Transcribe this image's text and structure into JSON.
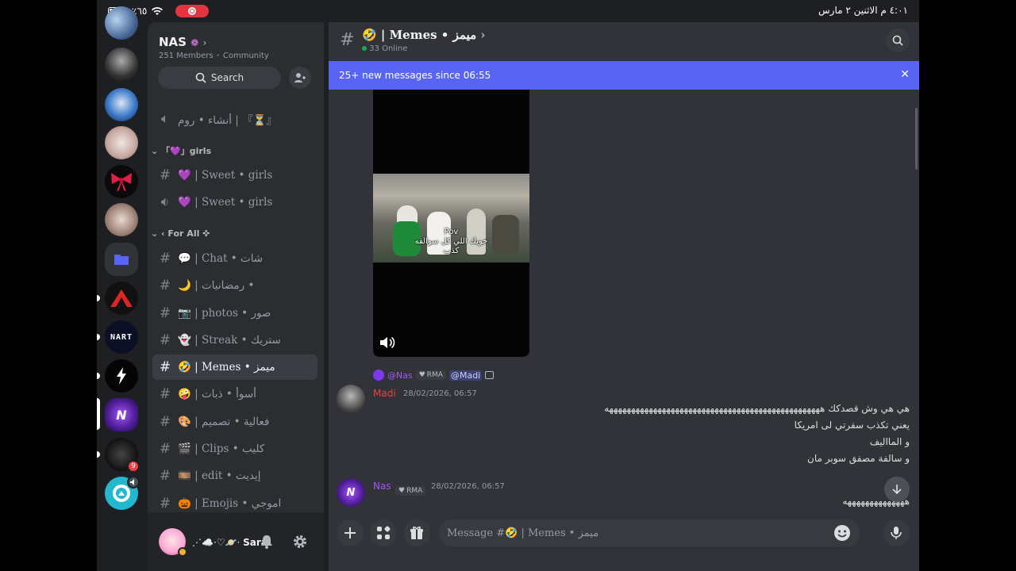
{
  "status_bar": {
    "battery": "٪٦٥",
    "datetime": "٤:٠١ م   الاثنين ٢ مارس"
  },
  "server": {
    "name": "NAS",
    "members": "251 Members",
    "type": "Community",
    "search_label": "Search"
  },
  "channels": [
    {
      "label": "أنشاء • روم | 『⏳』"
    },
    {
      "category": "「💜」girls"
    },
    {
      "label": "💜 | Sweet • girls"
    },
    {
      "label": "💜 | Sweet • girls"
    },
    {
      "category": "For All ✜"
    },
    {
      "label": "💬 | Chat • شات"
    },
    {
      "label": "🌙 | رمضانيات •"
    },
    {
      "label": "📷 | photos • صور"
    },
    {
      "label": "👻 | Streak • ستريك"
    },
    {
      "label": "🤣 | Memes • ميمز"
    },
    {
      "label": "🤪 | أسوأ • ذبات"
    },
    {
      "label": "🎨 | فعالية • تصميم"
    },
    {
      "label": "🎬 | Clips • كليب"
    },
    {
      "label": "🎞️ | edit • إيديت"
    },
    {
      "label": "🎃 | Emojis • اموجي"
    }
  ],
  "user": {
    "name": "Sara",
    "status": "⋰☁️·♡🪐·"
  },
  "main_header": {
    "channel": "🤣 | Memes • ميمز",
    "online": "33 Online"
  },
  "banner": {
    "text": "25+ new messages since 06:55"
  },
  "video": {
    "caption_1": "Pov",
    "caption_2": "خويك اللي كل سوالفه",
    "caption_3": "كذب"
  },
  "messages": [
    {
      "reply_to": "@Nas",
      "reply_tag": "RMA",
      "reply_mention": "@Madi",
      "author": "Madi",
      "time": "28/02/2026, 06:57",
      "lines": [
        "هي هي وش قصدكك هههههههههههههههههههههههههههههههههههههههههههههههههه",
        "يعني تكذب سفرتي لى امريكا",
        "و المااليف",
        "و سالفة مصفق سوبر مان"
      ]
    },
    {
      "author": "Nas",
      "tag": "RMA",
      "time": "28/02/2026, 06:57",
      "lines": [
        "ههههههههههههههه"
      ]
    }
  ],
  "composer": {
    "placeholder": "Message #🤣 | Memes • ميمز"
  },
  "colors": {
    "accent": "#5865f2",
    "madi": "#f23f43",
    "nas": "#a855f7"
  }
}
